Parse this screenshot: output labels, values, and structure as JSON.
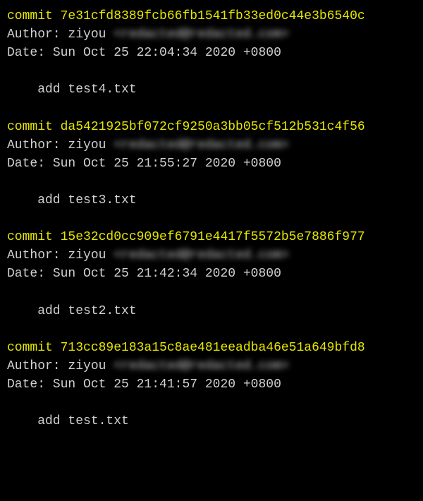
{
  "commits": [
    {
      "commit_label": "commit",
      "hash": "7e31cfd8389fcb66fb1541fb33ed0c44e3b6540c",
      "author_label": "Author:",
      "author_name": "ziyou",
      "author_email": "<redacted@redacted.com>",
      "date_label": "Date:  ",
      "date_value": "Sun Oct 25 22:04:34 2020 +0800",
      "message": "add test4.txt"
    },
    {
      "commit_label": "commit",
      "hash": "da5421925bf072cf9250a3bb05cf512b531c4f56",
      "author_label": "Author:",
      "author_name": "ziyou",
      "author_email": "<redacted@redacted.com>",
      "date_label": "Date:  ",
      "date_value": "Sun Oct 25 21:55:27 2020 +0800",
      "message": "add test3.txt"
    },
    {
      "commit_label": "commit",
      "hash": "15e32cd0cc909ef6791e4417f5572b5e7886f977",
      "author_label": "Author:",
      "author_name": "ziyou",
      "author_email": "<redacted@redacted.com>",
      "date_label": "Date:  ",
      "date_value": "Sun Oct 25 21:42:34 2020 +0800",
      "message": "add test2.txt"
    },
    {
      "commit_label": "commit",
      "hash": "713cc89e183a15c8ae481eeadba46e51a649bfd8",
      "author_label": "Author:",
      "author_name": "ziyou",
      "author_email": "<redacted@redacted.com>",
      "date_label": "Date:  ",
      "date_value": "Sun Oct 25 21:41:57 2020 +0800",
      "message": "add test.txt"
    }
  ]
}
